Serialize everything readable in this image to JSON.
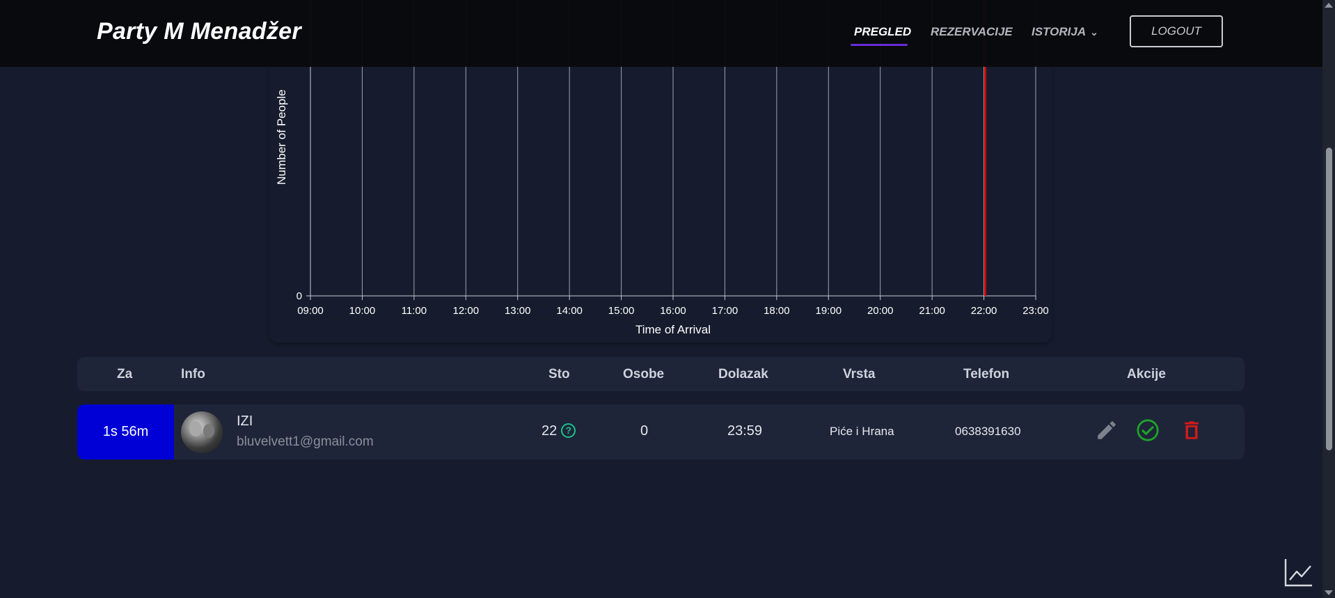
{
  "app": {
    "title": "Party M Menadžer"
  },
  "nav": {
    "items": [
      {
        "label": "PREGLED",
        "active": true
      },
      {
        "label": "REZERVACIJE",
        "active": false
      },
      {
        "label": "ISTORIJA",
        "active": false
      }
    ],
    "logout_label": "LOGOUT"
  },
  "chart_data": {
    "type": "line",
    "xlabel": "Time of Arrival",
    "ylabel": "Number of People",
    "x_ticks": [
      "09:00",
      "10:00",
      "11:00",
      "12:00",
      "13:00",
      "14:00",
      "15:00",
      "16:00",
      "17:00",
      "18:00",
      "19:00",
      "20:00",
      "21:00",
      "22:00",
      "23:00"
    ],
    "y_ticks": [
      "0"
    ],
    "grid": true,
    "current_time_marker": "22:00",
    "marker_color": "#d00000",
    "series": []
  },
  "table": {
    "headers": {
      "za": "Za",
      "info": "Info",
      "sto": "Sto",
      "osobe": "Osobe",
      "dolazak": "Dolazak",
      "vrsta": "Vrsta",
      "telefon": "Telefon",
      "akcije": "Akcije"
    },
    "rows": [
      {
        "za": "1s 56m",
        "name": "IZI",
        "email": "bluvelvett1@gmail.com",
        "sto": "22",
        "osobe": "0",
        "dolazak": "23:59",
        "vrsta": "Piće i Hrana",
        "telefon": "0638391630",
        "za_color": "#0000d6"
      }
    ]
  },
  "icons": {
    "sto_status": "help-circle-icon",
    "edit": "pencil-icon",
    "confirm": "check-circle-icon",
    "delete": "trash-icon",
    "stats": "line-chart-icon",
    "nav_dropdown": "chevron-down-icon"
  }
}
